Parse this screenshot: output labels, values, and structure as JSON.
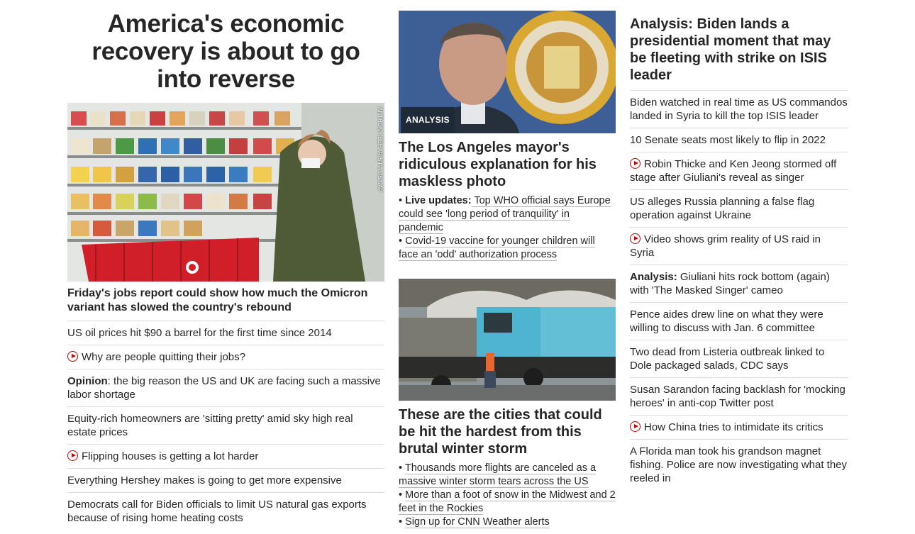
{
  "left": {
    "lead_title": "America's economic recovery is about to go into reverse",
    "lead_photo_credit": "ANTHONY BEHAR/SIPA USA/AP",
    "lead_subhead": "Friday's jobs report could show how much the Omicron variant has slowed the country's rebound",
    "items": [
      {
        "prefix": "",
        "text": "US oil prices hit $90 a barrel for the first time since 2014",
        "video": false
      },
      {
        "prefix": "",
        "text": "Why are people quitting their jobs?",
        "video": true
      },
      {
        "prefix": "Opinion",
        "text": ": the big reason the US and UK are facing such a massive labor shortage",
        "video": false
      },
      {
        "prefix": "",
        "text": "Equity-rich homeowners are 'sitting pretty' amid sky high real estate prices",
        "video": false
      },
      {
        "prefix": "",
        "text": "Flipping houses is getting a lot harder",
        "video": true
      },
      {
        "prefix": "",
        "text": "Everything Hershey makes is going to get more expensive",
        "video": false
      },
      {
        "prefix": "",
        "text": "Democrats call for Biden officials to limit US natural gas exports because of rising home heating costs",
        "video": false
      }
    ]
  },
  "middle": {
    "story1": {
      "badge": "ANALYSIS",
      "headline": "The Los Angeles mayor's ridiculous explanation for his maskless photo",
      "bullets": [
        {
          "bold": "Live updates:",
          "text": " Top WHO official says Europe could see 'long period of tranquility' in pandemic"
        },
        {
          "bold": "",
          "text": "Covid-19 vaccine for younger children will face an 'odd' authorization process"
        }
      ]
    },
    "story2": {
      "headline": "These are the cities that could be hit the hardest from this brutal winter storm",
      "bullets": [
        {
          "bold": "",
          "text": "Thousands more flights are canceled as a massive winter storm tears across the US"
        },
        {
          "bold": "",
          "text": "More than a foot of snow in the Midwest and 2 feet in the Rockies"
        },
        {
          "bold": "",
          "text": "Sign up for CNN Weather alerts"
        }
      ]
    }
  },
  "right": {
    "headline": "Analysis: Biden lands a presidential moment that may be fleeting with strike on ISIS leader",
    "items": [
      {
        "prefix": "",
        "text": "Biden watched in real time as US commandos landed in Syria to kill the top ISIS leader",
        "video": false
      },
      {
        "prefix": "",
        "text": "10 Senate seats most likely to flip in 2022",
        "video": false
      },
      {
        "prefix": "",
        "text": "Robin Thicke and Ken Jeong stormed off stage after Giuliani's reveal as singer",
        "video": true
      },
      {
        "prefix": "",
        "text": "US alleges Russia planning a false flag operation against Ukraine",
        "video": false
      },
      {
        "prefix": "",
        "text": "Video shows grim reality of US raid in Syria",
        "video": true
      },
      {
        "prefix": "Analysis:",
        "text": " Giuliani hits rock bottom (again) with 'The Masked Singer' cameo",
        "video": false
      },
      {
        "prefix": "",
        "text": "Pence aides drew line on what they were willing to discuss with Jan. 6 committee",
        "video": false
      },
      {
        "prefix": "",
        "text": "Two dead from Listeria outbreak linked to Dole packaged salads, CDC says",
        "video": false
      },
      {
        "prefix": "",
        "text": "Susan Sarandon facing backlash for 'mocking heroes' in anti-cop Twitter post",
        "video": false
      },
      {
        "prefix": "",
        "text": "How China tries to intimidate its critics",
        "video": true
      },
      {
        "prefix": "",
        "text": "A Florida man took his grandson magnet fishing. Police are now investigating what they reeled in",
        "video": false
      }
    ]
  },
  "colors": {
    "text": "#262626",
    "divider": "#dedede",
    "video_icon": "#cc0000",
    "badge_bg": "#1e2a37"
  }
}
